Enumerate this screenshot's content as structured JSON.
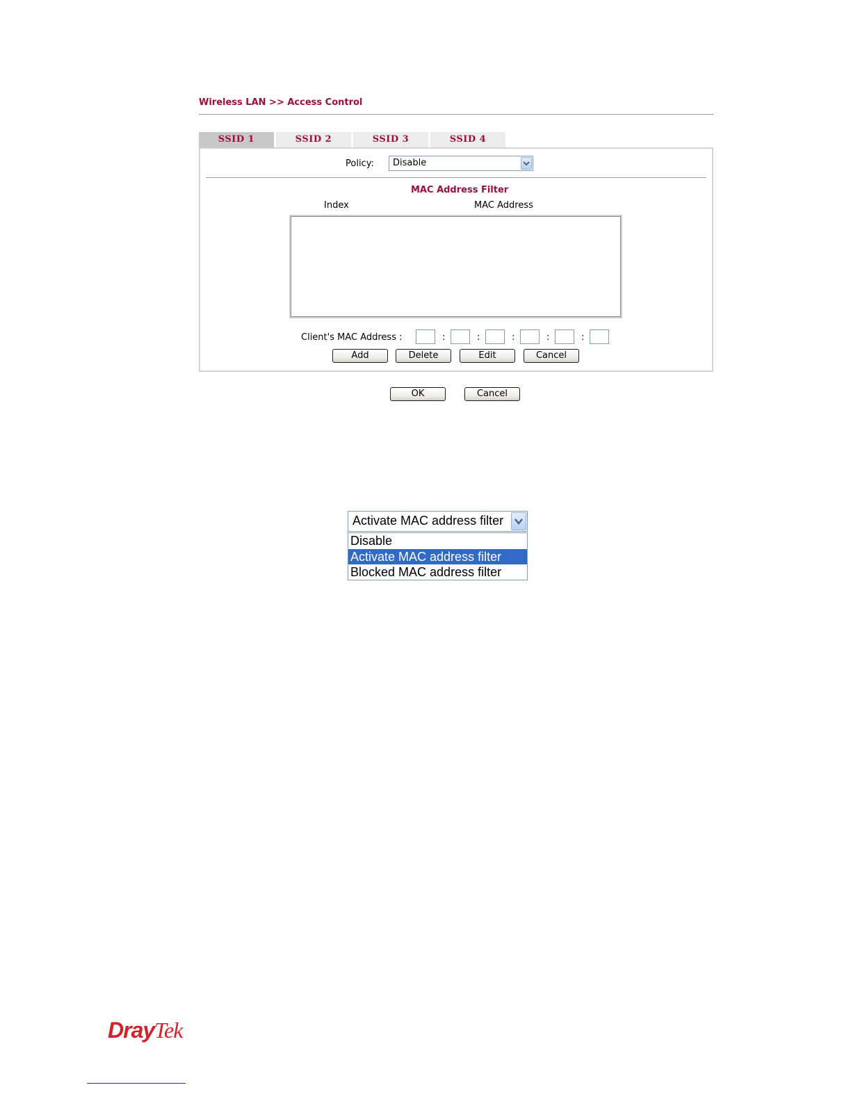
{
  "breadcrumb": "Wireless LAN >> Access Control",
  "tabs": [
    {
      "label": "SSID 1",
      "active": true
    },
    {
      "label": "SSID 2",
      "active": false
    },
    {
      "label": "SSID 3",
      "active": false
    },
    {
      "label": "SSID 4",
      "active": false
    }
  ],
  "policy": {
    "label": "Policy:",
    "value": "Disable"
  },
  "mac_filter": {
    "title": "MAC Address Filter",
    "col_index": "Index",
    "col_mac": "MAC Address",
    "client_label": "Client's MAC Address :",
    "colon": ":",
    "buttons": {
      "add": "Add",
      "delete": "Delete",
      "edit": "Edit",
      "cancel": "Cancel"
    }
  },
  "footer_buttons": {
    "ok": "OK",
    "cancel": "Cancel"
  },
  "policy_dropdown_example": {
    "selected": "Activate MAC address filter",
    "options": [
      "Disable",
      "Activate MAC address filter",
      "Blocked MAC address filter"
    ],
    "highlighted_index": 1
  },
  "logo": {
    "part1": "Dray",
    "part2": "Tek"
  },
  "colors": {
    "brand": "#9c0f3c",
    "logo": "#d2232a",
    "selection": "#316ac5"
  },
  "icons": [
    "chevron-down-icon"
  ]
}
